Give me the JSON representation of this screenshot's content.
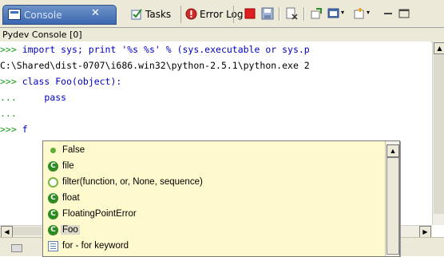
{
  "tabs": {
    "active": {
      "label": "Console",
      "close": "✕"
    },
    "items": [
      {
        "label": "Tasks"
      },
      {
        "label": "Error Log"
      }
    ]
  },
  "panel": {
    "title": "Pydev Console [0]"
  },
  "console": {
    "lines": [
      {
        "prompt": ">>>",
        "text": " import sys; print '%s %s' % (sys.executable or sys.p"
      },
      {
        "prompt": "",
        "text": "C:\\Shared\\dist-0707\\i686.win32\\python-2.5.1\\python.exe 2"
      },
      {
        "prompt": ">>>",
        "text": " class Foo(object):"
      },
      {
        "prompt": "...",
        "text": "     pass"
      },
      {
        "prompt": "...",
        "text": ""
      },
      {
        "prompt": ">>>",
        "text": " f"
      }
    ]
  },
  "autocomplete": {
    "items": [
      {
        "label": "False",
        "icon": "dot-icon"
      },
      {
        "label": "file",
        "icon": "class-icon"
      },
      {
        "label": "filter(function, or, None, sequence)",
        "icon": "function-icon"
      },
      {
        "label": "float",
        "icon": "class-icon"
      },
      {
        "label": "FloatingPointError",
        "icon": "class-icon"
      },
      {
        "label": "Foo",
        "icon": "class-icon",
        "selected": true
      },
      {
        "label": "for - for keyword",
        "icon": "keyword-icon"
      }
    ]
  },
  "colors": {
    "prompt": "#1a9a1a",
    "code": "#0000c0",
    "popup_bg": "#fffacd",
    "tab_active": "#3c67b0"
  }
}
